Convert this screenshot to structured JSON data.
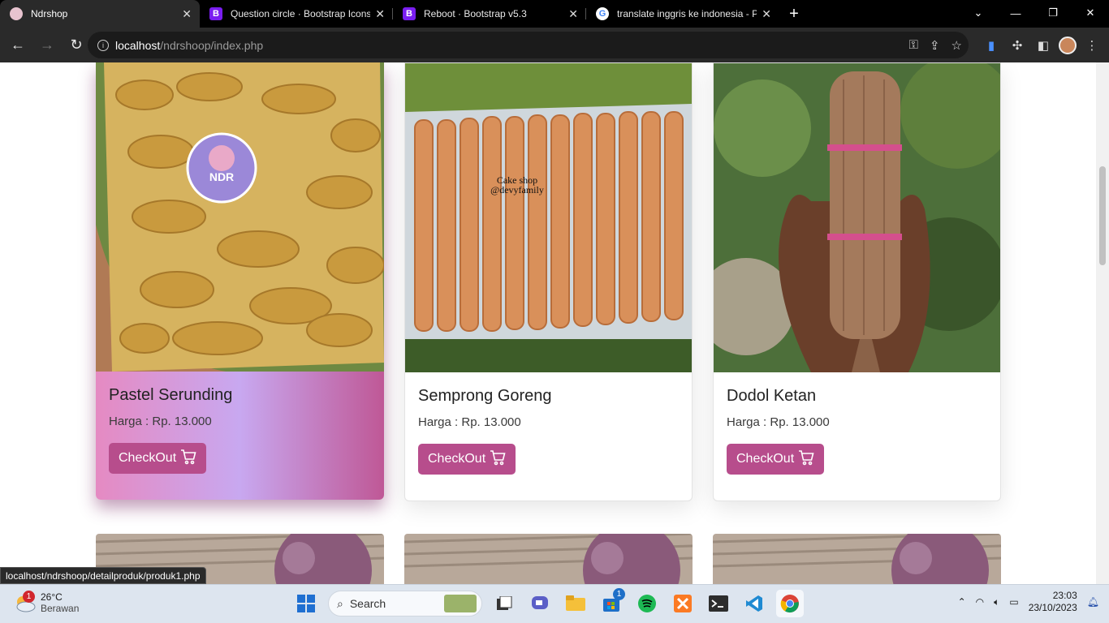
{
  "browser": {
    "tabs": [
      {
        "title": "Ndrshop",
        "active": true,
        "icon": "ndrshop-favicon"
      },
      {
        "title": "Question circle · Bootstrap Icons",
        "active": false,
        "icon": "bootstrap-icon"
      },
      {
        "title": "Reboot · Bootstrap v5.3",
        "active": false,
        "icon": "bootstrap-icon"
      },
      {
        "title": "translate inggris ke indonesia - P",
        "active": false,
        "icon": "google-icon"
      }
    ],
    "url_host": "localhost",
    "url_path": "/ndrshoop/index.php",
    "status_url": "localhost/ndrshoop/detailproduk/produk1.php"
  },
  "products": [
    {
      "name": "Pastel Serunding",
      "price": "Harga : Rp. 13.000",
      "button": "CheckOut"
    },
    {
      "name": "Semprong Goreng",
      "price": "Harga : Rp. 13.000",
      "button": "CheckOut"
    },
    {
      "name": "Dodol Ketan",
      "price": "Harga : Rp. 13.000",
      "button": "CheckOut"
    }
  ],
  "watermark": {
    "line1": "Cake shop",
    "line2": "@devyfamily"
  },
  "taskbar": {
    "temperature": "26°C",
    "weather": "Berawan",
    "search_placeholder": "Search",
    "time": "23:03",
    "date": "23/10/2023",
    "weather_badge": "1",
    "store_badge": "1"
  },
  "colors": {
    "accent": "#b74d8c",
    "tab_bg": "#000000",
    "toolbar_bg": "#2a2a2a"
  }
}
